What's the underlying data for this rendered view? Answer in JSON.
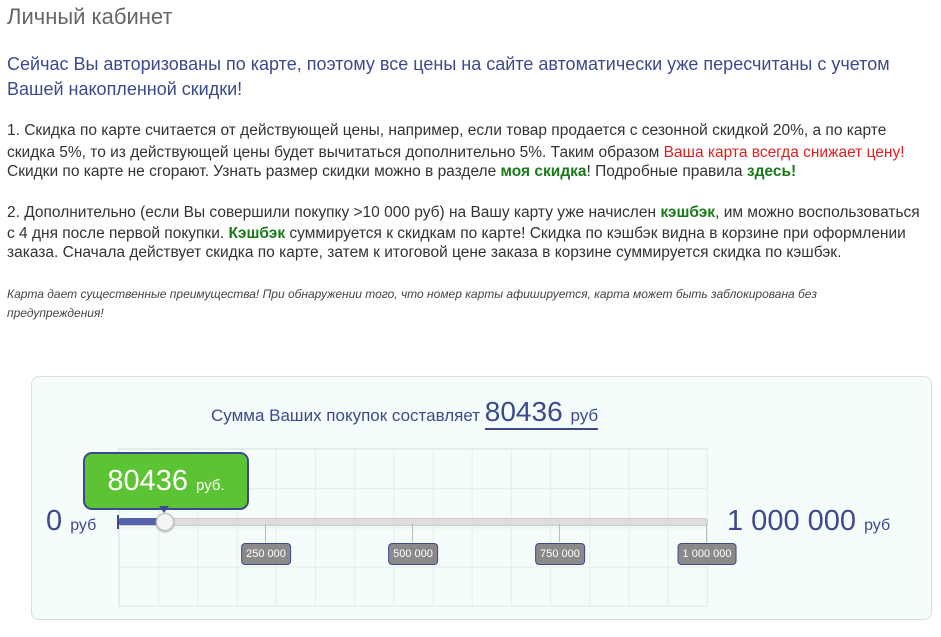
{
  "title": "Личный кабинет",
  "lead": [
    "Сейчас Вы авторизованы по карте, поэтому все цены на сайте автоматически уже пересчитаны с учетом",
    "Вашей накопленной скидки!"
  ],
  "p1": {
    "l1": "1. Скидка по карте считается от действующей цены, например, если товар продается с сезонной скидкой 20%, а по карте",
    "l2a": "скидка 5%, то из действующей цены будет вычитаться дополнительно 5%. Таким образом ",
    "l2b": "Ваша карта всегда снижает цену!",
    "l3a": "Скидки по карте не сгорают. Узнать размер скидки можно в разделе ",
    "l3link": "моя скидка",
    "l3b": "!  Подробные правила ",
    "l3link2": "здесь",
    "l3c": "!"
  },
  "p2": {
    "l1a": "2. Дополнительно (если Вы совершили покупку >10 000 руб) на Вашу карту уже начислен ",
    "l1b": "кэшбэк",
    "l1c": ", им можно воспользоваться",
    "l2a": "с 4 дня после первой покупки. ",
    "l2b": "Кэшбэк",
    "l2c": " суммируется к скидкам по карте! Скидка по кэшбэк видна в корзине при оформлении",
    "l3": "заказа. Сначала действует скидка по карте, затем к итоговой цене заказа в корзине суммируется скидка по кэшбэк."
  },
  "note": [
    "Карта дает существенные преимущества! При обнаружении того, что номер карты афишируется, карта может быть заблокирована без",
    "предупреждения!"
  ],
  "slider": {
    "label": "Сумма Ваших покупок составляет",
    "value": "80436",
    "unit": "руб",
    "tip_unit": "руб.",
    "value_num": 80436,
    "min": "0",
    "max": "1 000 000",
    "max_num": 1000000,
    "ticks": [
      {
        "v": 250000,
        "label": "250 000"
      },
      {
        "v": 500000,
        "label": "500 000"
      },
      {
        "v": 750000,
        "label": "750 000"
      },
      {
        "v": 1000000,
        "label": "1 000 000"
      }
    ]
  }
}
